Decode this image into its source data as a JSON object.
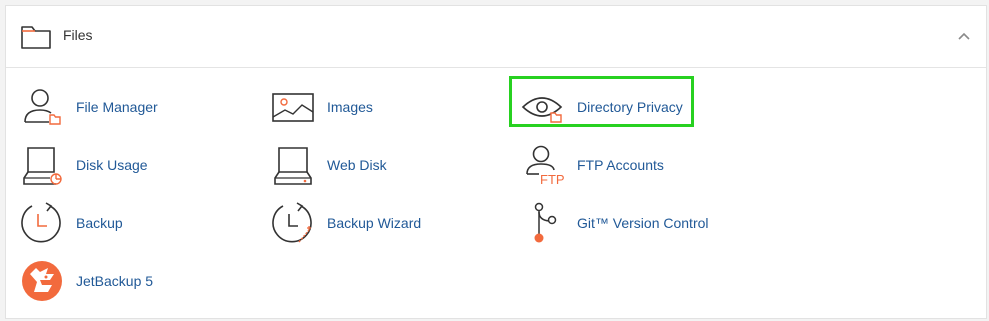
{
  "section": {
    "title": "Files",
    "icon": "folder-icon",
    "collapse_icon": "chevron-up-icon"
  },
  "items": [
    {
      "label": "File Manager",
      "icon": "user-folder-icon"
    },
    {
      "label": "Images",
      "icon": "image-icon"
    },
    {
      "label": "Directory Privacy",
      "icon": "eye-folder-icon"
    },
    {
      "label": "Disk Usage",
      "icon": "disk-pie-icon"
    },
    {
      "label": "Web Disk",
      "icon": "drive-icon"
    },
    {
      "label": "FTP Accounts",
      "icon": "user-ftp-icon",
      "icon_text": "FTP"
    },
    {
      "label": "Backup",
      "icon": "backup-clock-icon"
    },
    {
      "label": "Backup Wizard",
      "icon": "backup-wand-icon"
    },
    {
      "label": "Git™ Version Control",
      "icon": "git-branch-icon"
    },
    {
      "label": "JetBackup 5",
      "icon": "jetbackup-logo-icon"
    }
  ],
  "colors": {
    "link": "#215997",
    "accent": "#f26a3d",
    "highlight_border": "#27d120"
  }
}
